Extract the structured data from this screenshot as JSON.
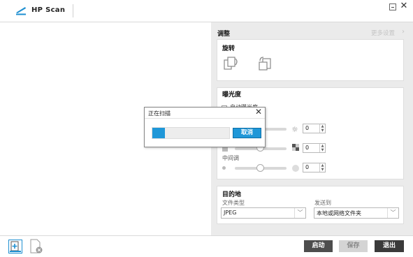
{
  "app": {
    "title": "HP Scan",
    "logo_icon": "hp-scan-logo-icon",
    "controls": {
      "minimize_icon": "minimize-icon",
      "close_icon": "close-icon"
    }
  },
  "adjust": {
    "title": "调整",
    "more_settings": "更多设置",
    "rotate": {
      "title": "旋转",
      "rotate_left_icon": "rotate-left-icon",
      "rotate_right_icon": "rotate-right-icon"
    },
    "exposure": {
      "title": "曝光度",
      "auto_exposure_label": "自动曝光度",
      "brightness": {
        "value": "0",
        "level": 0.5,
        "icon": "brightness-icon"
      },
      "contrast": {
        "value": "0",
        "level": 0.5,
        "icon": "contrast-icon"
      },
      "midtone": {
        "label": "中间调",
        "value": "0",
        "level": 0.5
      }
    }
  },
  "destination": {
    "title": "目的地",
    "file_type_label": "文件类型",
    "file_type_value": "JPEG",
    "send_to_label": "发送到",
    "send_to_value": "本地或网络文件夹"
  },
  "bottom": {
    "new_scan_icon": "new-scan-icon",
    "delete_icon": "delete-scan-icon",
    "start_label": "启动",
    "save_label": "保存",
    "exit_label": "退出"
  },
  "dialog": {
    "title": "正在扫描",
    "progress": 0.16,
    "cancel_label": "取消"
  },
  "colors": {
    "accent": "#1f97d8",
    "panel_bg": "#ebebeb",
    "dark_button": "#3a3a3a"
  }
}
